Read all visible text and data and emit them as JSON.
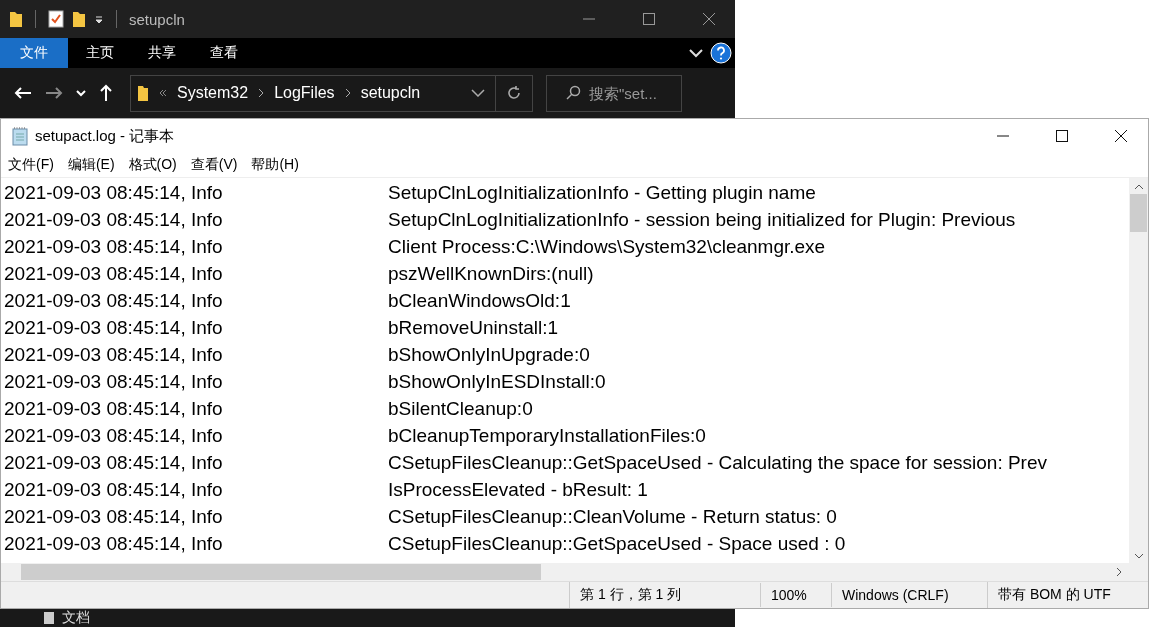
{
  "explorer": {
    "title": "setupcln",
    "ribbon_tabs": [
      {
        "label": "文件",
        "selected": true
      },
      {
        "label": "主页",
        "selected": false
      },
      {
        "label": "共享",
        "selected": false
      },
      {
        "label": "查看",
        "selected": false
      }
    ],
    "breadcrumb": [
      "System32",
      "LogFiles",
      "setupcln"
    ],
    "search": {
      "placeholder": "搜索\"set..."
    },
    "nav_item": "文档"
  },
  "notepad": {
    "title": "setupact.log - 记事本",
    "menu": [
      "文件(F)",
      "编辑(E)",
      "格式(O)",
      "查看(V)",
      "帮助(H)"
    ],
    "lines": [
      {
        "time": "2021-09-03 08:45:14, Info",
        "message": "SetupClnLogInitializationInfo - Getting plugin name"
      },
      {
        "time": "2021-09-03 08:45:14, Info",
        "message": "SetupClnLogInitializationInfo - session being initialized for Plugin: Previous"
      },
      {
        "time": "2021-09-03 08:45:14, Info",
        "message": "Client Process:C:\\Windows\\System32\\cleanmgr.exe"
      },
      {
        "time": "2021-09-03 08:45:14, Info",
        "message": "pszWellKnownDirs:(null)"
      },
      {
        "time": "2021-09-03 08:45:14, Info",
        "message": "bCleanWindowsOld:1"
      },
      {
        "time": "2021-09-03 08:45:14, Info",
        "message": "bRemoveUninstall:1"
      },
      {
        "time": "2021-09-03 08:45:14, Info",
        "message": "bShowOnlyInUpgrade:0"
      },
      {
        "time": "2021-09-03 08:45:14, Info",
        "message": "bShowOnlyInESDInstall:0"
      },
      {
        "time": "2021-09-03 08:45:14, Info",
        "message": "bSilentCleanup:0"
      },
      {
        "time": "2021-09-03 08:45:14, Info",
        "message": "bCleanupTemporaryInstallationFiles:0"
      },
      {
        "time": "2021-09-03 08:45:14, Info",
        "message": "CSetupFilesCleanup::GetSpaceUsed - Calculating the space for session: Prev"
      },
      {
        "time": "2021-09-03 08:45:14, Info",
        "message": "IsProcessElevated - bResult: 1"
      },
      {
        "time": "2021-09-03 08:45:14, Info",
        "message": "CSetupFilesCleanup::CleanVolume - Return status: 0"
      },
      {
        "time": "2021-09-03 08:45:14, Info",
        "message": "CSetupFilesCleanup::GetSpaceUsed - Space used : 0"
      }
    ],
    "status": [
      "第 1 行，第 1 列",
      "100%",
      "Windows (CRLF)",
      "带有 BOM 的 UTF"
    ]
  }
}
